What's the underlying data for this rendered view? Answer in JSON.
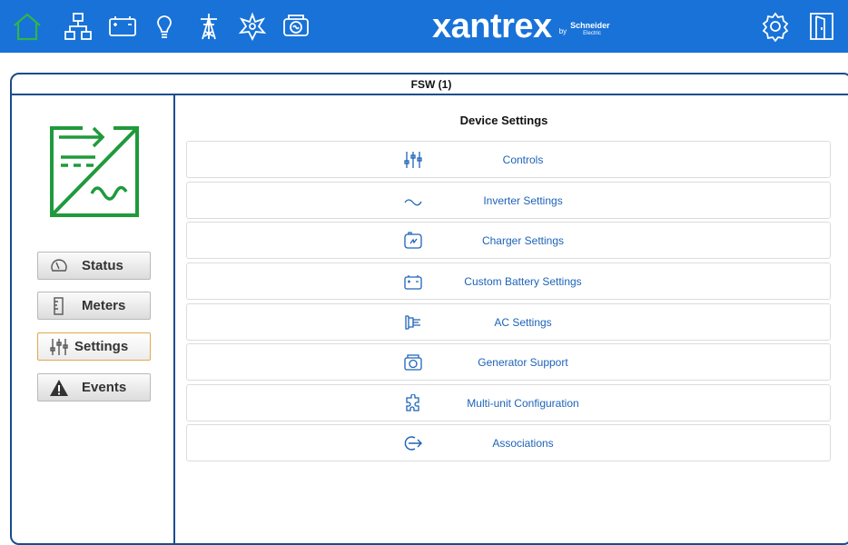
{
  "brand": {
    "name": "xantrex",
    "by": "by",
    "partner": "Schneider",
    "partner_sub": "Electric"
  },
  "nav": [
    {
      "name": "home-icon"
    },
    {
      "name": "network-icon"
    },
    {
      "name": "battery-icon"
    },
    {
      "name": "bulb-icon"
    },
    {
      "name": "tower-icon"
    },
    {
      "name": "sun-icon"
    },
    {
      "name": "generator-icon"
    },
    {
      "name": "settings-gear-icon"
    },
    {
      "name": "exit-door-icon"
    }
  ],
  "panel": {
    "title": "FSW (1)"
  },
  "sidebar": {
    "device_icon": "inverter-charger-icon",
    "buttons": [
      {
        "label": "Status",
        "icon": "gauge-icon",
        "active": false
      },
      {
        "label": "Meters",
        "icon": "meter-icon",
        "active": false
      },
      {
        "label": "Settings",
        "icon": "sliders-icon",
        "active": true
      },
      {
        "label": "Events",
        "icon": "warning-icon",
        "active": false
      }
    ]
  },
  "content": {
    "heading": "Device Settings",
    "items": [
      {
        "label": "Controls",
        "icon": "sliders-icon"
      },
      {
        "label": "Inverter Settings",
        "icon": "sine-wave-icon"
      },
      {
        "label": "Charger Settings",
        "icon": "charger-icon"
      },
      {
        "label": "Custom Battery Settings",
        "icon": "battery-icon"
      },
      {
        "label": "AC Settings",
        "icon": "ac-plug-icon"
      },
      {
        "label": "Generator Support",
        "icon": "generator-icon"
      },
      {
        "label": "Multi-unit Configuration",
        "icon": "puzzle-icon"
      },
      {
        "label": "Associations",
        "icon": "association-arrow-icon"
      }
    ]
  },
  "colors": {
    "topbar": "#1872d8",
    "home_active": "#2fb54a",
    "panel_border": "#1a4c8c",
    "device_green": "#1f9a3c",
    "link_blue": "#1d63b8",
    "active_outline": "#e0a94a"
  }
}
